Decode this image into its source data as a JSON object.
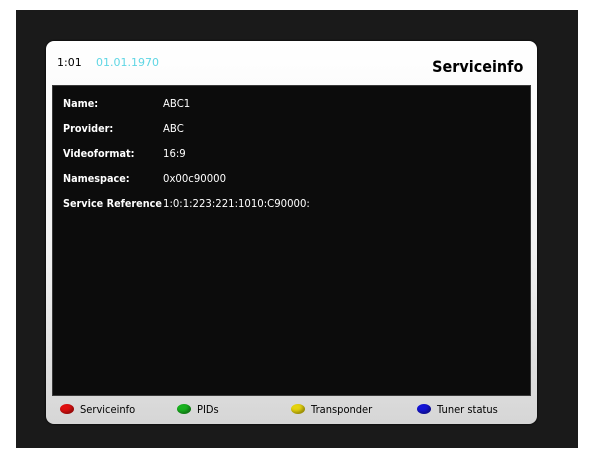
{
  "header": {
    "time": "1:01",
    "date": "01.01.1970",
    "title": "Serviceinfo"
  },
  "info": {
    "rows": [
      {
        "label": "Name:",
        "value": "ABC1"
      },
      {
        "label": "Provider:",
        "value": "ABC"
      },
      {
        "label": "Videoformat:",
        "value": "16:9"
      },
      {
        "label": "Namespace:",
        "value": "0x00c90000"
      },
      {
        "label": "Service Reference",
        "value": "1:0:1:223:221:1010:C90000:"
      }
    ]
  },
  "footer": {
    "buttons": [
      {
        "label": "Serviceinfo",
        "color": "#e01010"
      },
      {
        "label": "PIDs",
        "color": "#19b21f"
      },
      {
        "label": "Transponder",
        "color": "#e6d40e"
      },
      {
        "label": "Tuner status",
        "color": "#1414d6"
      }
    ]
  },
  "colors": {
    "date": "#5fd6e4",
    "background": "#1a1a1a"
  }
}
